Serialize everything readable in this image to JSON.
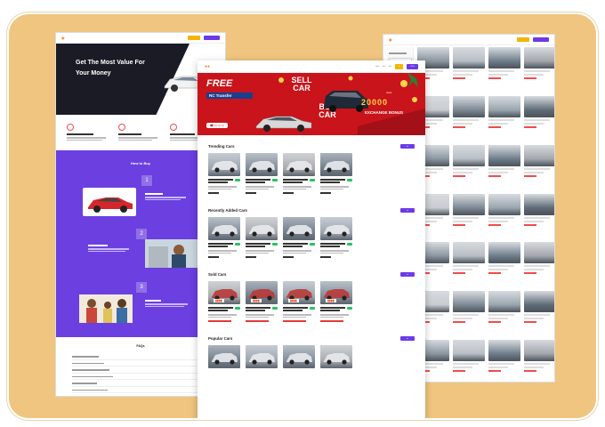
{
  "left_page": {
    "hero_title": "Get The Most Value For Your Money",
    "how_to_buy": "How to Buy",
    "faqs_title": "FAQs"
  },
  "center_page": {
    "banner": {
      "free": "FREE",
      "rc_transfer": "RC Transfer",
      "sell": "SELL CAR",
      "buy": "BUY CAR",
      "upto": "Upto",
      "amount": "20000",
      "exchange_bonus": "EXCHANGE BONUS"
    },
    "sections": [
      {
        "title": "Trending Cars"
      },
      {
        "title": "Recently Added Cars"
      },
      {
        "title": "Sold Cars"
      },
      {
        "title": "Popular Cars"
      }
    ]
  },
  "colors": {
    "frame": "#efc57f",
    "purple": "#6b3fe0",
    "banner_red": "#c8141a",
    "accent_yellow": "#f5b400"
  }
}
